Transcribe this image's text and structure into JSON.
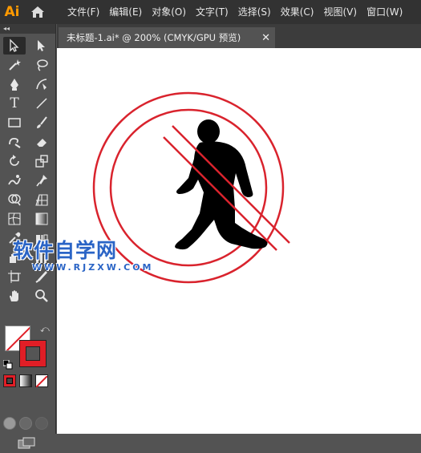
{
  "app": {
    "logo": "Ai",
    "home_icon": "home-icon"
  },
  "menu": [
    "文件(F)",
    "编辑(E)",
    "对象(O)",
    "文字(T)",
    "选择(S)",
    "效果(C)",
    "视图(V)",
    "窗口(W)"
  ],
  "toolbar": {
    "collapse": "◂◂",
    "tools": [
      "selection-tool-icon",
      "direct-selection-tool-icon",
      "magic-wand-tool-icon",
      "lasso-tool-icon",
      "pen-tool-icon",
      "curvature-tool-icon",
      "type-tool-icon",
      "line-tool-icon",
      "rectangle-tool-icon",
      "paintbrush-tool-icon",
      "shaper-tool-icon",
      "eraser-tool-icon",
      "rotate-tool-icon",
      "scale-tool-icon",
      "warp-tool-icon",
      "puppet-warp-tool-icon",
      "shape-builder-tool-icon",
      "perspective-grid-tool-icon",
      "mesh-tool-icon",
      "gradient-tool-icon",
      "eyedropper-tool-icon",
      "blend-tool-icon",
      "symbol-sprayer-tool-icon",
      "column-graph-tool-icon",
      "artboard-tool-icon",
      "slice-tool-icon",
      "hand-tool-icon",
      "zoom-tool-icon"
    ],
    "type_glyph": "T",
    "colors": {
      "fill": "#ffffff",
      "stroke": "#e01e26"
    }
  },
  "document": {
    "tab_title": "未标题-1.ai* @ 200% (CMYK/GPU 预览)",
    "close": "✕"
  },
  "watermark": {
    "title": "软件自学网",
    "url": "WWW.RJZXW.COM"
  },
  "artwork": {
    "sign_color": "#d9232d",
    "figure_color": "#000000"
  }
}
